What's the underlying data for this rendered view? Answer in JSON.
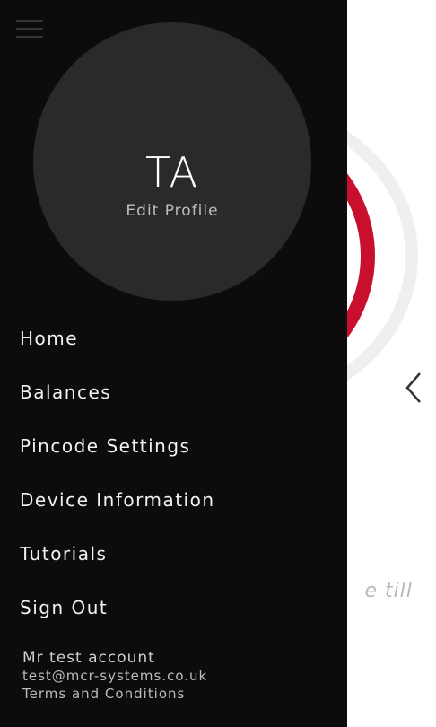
{
  "drawer": {
    "avatar": {
      "initials": "TA",
      "edit_label": "Edit Profile"
    },
    "menu": [
      {
        "label": "Home"
      },
      {
        "label": "Balances"
      },
      {
        "label": "Pincode Settings"
      },
      {
        "label": "Device Information"
      },
      {
        "label": "Tutorials"
      },
      {
        "label": "Sign Out"
      }
    ],
    "footer": {
      "name": "Mr test account",
      "email": "test@mcr-systems.co.uk",
      "terms_label": "Terms and Conditions"
    }
  },
  "background": {
    "caption": "e till",
    "icons": [
      "qr-code",
      "chevron-left"
    ]
  },
  "colors": {
    "drawer_bg": "#0c0c0c",
    "accent": "#c8102e",
    "avatar_bg": "#2a2a2a"
  }
}
